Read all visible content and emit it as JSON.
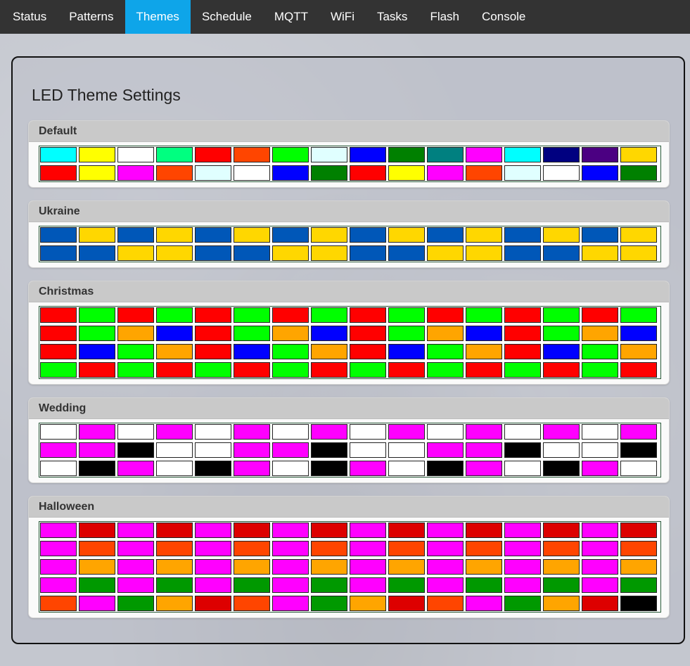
{
  "nav": {
    "items": [
      "Status",
      "Patterns",
      "Themes",
      "Schedule",
      "MQTT",
      "WiFi",
      "Tasks",
      "Flash",
      "Console"
    ],
    "active": "Themes",
    "active_color": "#0ea5e9",
    "bar_color": "#333333"
  },
  "page": {
    "title": "LED Theme Settings"
  },
  "themes": [
    {
      "name": "Default",
      "rows": [
        [
          "#00ffff",
          "#ffff00",
          "#ffffff",
          "#00ff80",
          "#ff0000",
          "#ff4500",
          "#00ff00",
          "#e0ffff",
          "#0000ff",
          "#008000",
          "#008080",
          "#ff00ff",
          "#00ffff",
          "#000080",
          "#4b0082",
          "#ffd700"
        ],
        [
          "#ff0000",
          "#ffff00",
          "#ff00ff",
          "#ff4500",
          "#e0ffff",
          "#ffffff",
          "#0000ff",
          "#008000",
          "#ff0000",
          "#ffff00",
          "#ff00ff",
          "#ff4500",
          "#e0ffff",
          "#ffffff",
          "#0000ff",
          "#008000"
        ]
      ]
    },
    {
      "name": "Ukraine",
      "rows": [
        [
          "#0057b8",
          "#ffd700",
          "#0057b8",
          "#ffd700",
          "#0057b8",
          "#ffd700",
          "#0057b8",
          "#ffd700",
          "#0057b8",
          "#ffd700",
          "#0057b8",
          "#ffd700",
          "#0057b8",
          "#ffd700",
          "#0057b8",
          "#ffd700"
        ],
        [
          "#0057b8",
          "#0057b8",
          "#ffd700",
          "#ffd700",
          "#0057b8",
          "#0057b8",
          "#ffd700",
          "#ffd700",
          "#0057b8",
          "#0057b8",
          "#ffd700",
          "#ffd700",
          "#0057b8",
          "#0057b8",
          "#ffd700",
          "#ffd700"
        ]
      ]
    },
    {
      "name": "Christmas",
      "rows": [
        [
          "#ff0000",
          "#00ff00",
          "#ff0000",
          "#00ff00",
          "#ff0000",
          "#00ff00",
          "#ff0000",
          "#00ff00",
          "#ff0000",
          "#00ff00",
          "#ff0000",
          "#00ff00",
          "#ff0000",
          "#00ff00",
          "#ff0000",
          "#00ff00"
        ],
        [
          "#ff0000",
          "#00ff00",
          "#ffa500",
          "#0000ff",
          "#ff0000",
          "#00ff00",
          "#ffa500",
          "#0000ff",
          "#ff0000",
          "#00ff00",
          "#ffa500",
          "#0000ff",
          "#ff0000",
          "#00ff00",
          "#ffa500",
          "#0000ff"
        ],
        [
          "#ff0000",
          "#0000ff",
          "#00ff00",
          "#ffa500",
          "#ff0000",
          "#0000ff",
          "#00ff00",
          "#ffa500",
          "#ff0000",
          "#0000ff",
          "#00ff00",
          "#ffa500",
          "#ff0000",
          "#0000ff",
          "#00ff00",
          "#ffa500"
        ],
        [
          "#00ff00",
          "#ff0000",
          "#00ff00",
          "#ff0000",
          "#00ff00",
          "#ff0000",
          "#00ff00",
          "#ff0000",
          "#00ff00",
          "#ff0000",
          "#00ff00",
          "#ff0000",
          "#00ff00",
          "#ff0000",
          "#00ff00",
          "#ff0000"
        ]
      ]
    },
    {
      "name": "Wedding",
      "rows": [
        [
          "#ffffff",
          "#ff00ff",
          "#ffffff",
          "#ff00ff",
          "#ffffff",
          "#ff00ff",
          "#ffffff",
          "#ff00ff",
          "#ffffff",
          "#ff00ff",
          "#ffffff",
          "#ff00ff",
          "#ffffff",
          "#ff00ff",
          "#ffffff",
          "#ff00ff"
        ],
        [
          "#ff00ff",
          "#ff00ff",
          "#000000",
          "#ffffff",
          "#ffffff",
          "#ff00ff",
          "#ff00ff",
          "#000000",
          "#ffffff",
          "#ffffff",
          "#ff00ff",
          "#ff00ff",
          "#000000",
          "#ffffff",
          "#ffffff",
          "#000000"
        ],
        [
          "#ffffff",
          "#000000",
          "#ff00ff",
          "#ffffff",
          "#000000",
          "#ff00ff",
          "#ffffff",
          "#000000",
          "#ff00ff",
          "#ffffff",
          "#000000",
          "#ff00ff",
          "#ffffff",
          "#000000",
          "#ff00ff",
          "#ffffff"
        ]
      ]
    },
    {
      "name": "Halloween",
      "rows": [
        [
          "#ff00ff",
          "#dd0000",
          "#ff00ff",
          "#dd0000",
          "#ff00ff",
          "#dd0000",
          "#ff00ff",
          "#dd0000",
          "#ff00ff",
          "#dd0000",
          "#ff00ff",
          "#dd0000",
          "#ff00ff",
          "#dd0000",
          "#ff00ff",
          "#dd0000"
        ],
        [
          "#ff00ff",
          "#ff4500",
          "#ff00ff",
          "#ff4500",
          "#ff00ff",
          "#ff4500",
          "#ff00ff",
          "#ff4500",
          "#ff00ff",
          "#ff4500",
          "#ff00ff",
          "#ff4500",
          "#ff00ff",
          "#ff4500",
          "#ff00ff",
          "#ff4500"
        ],
        [
          "#ff00ff",
          "#ffa500",
          "#ff00ff",
          "#ffa500",
          "#ff00ff",
          "#ffa500",
          "#ff00ff",
          "#ffa500",
          "#ff00ff",
          "#ffa500",
          "#ff00ff",
          "#ffa500",
          "#ff00ff",
          "#ffa500",
          "#ff00ff",
          "#ffa500"
        ],
        [
          "#ff00ff",
          "#009900",
          "#ff00ff",
          "#009900",
          "#ff00ff",
          "#009900",
          "#ff00ff",
          "#009900",
          "#ff00ff",
          "#009900",
          "#ff00ff",
          "#009900",
          "#ff00ff",
          "#009900",
          "#ff00ff",
          "#009900"
        ],
        [
          "#ff4500",
          "#ff00ff",
          "#009900",
          "#ffa500",
          "#dd0000",
          "#ff4500",
          "#ff00ff",
          "#009900",
          "#ffa500",
          "#dd0000",
          "#ff4500",
          "#ff00ff",
          "#009900",
          "#ffa500",
          "#dd0000",
          "#000000"
        ]
      ]
    }
  ]
}
